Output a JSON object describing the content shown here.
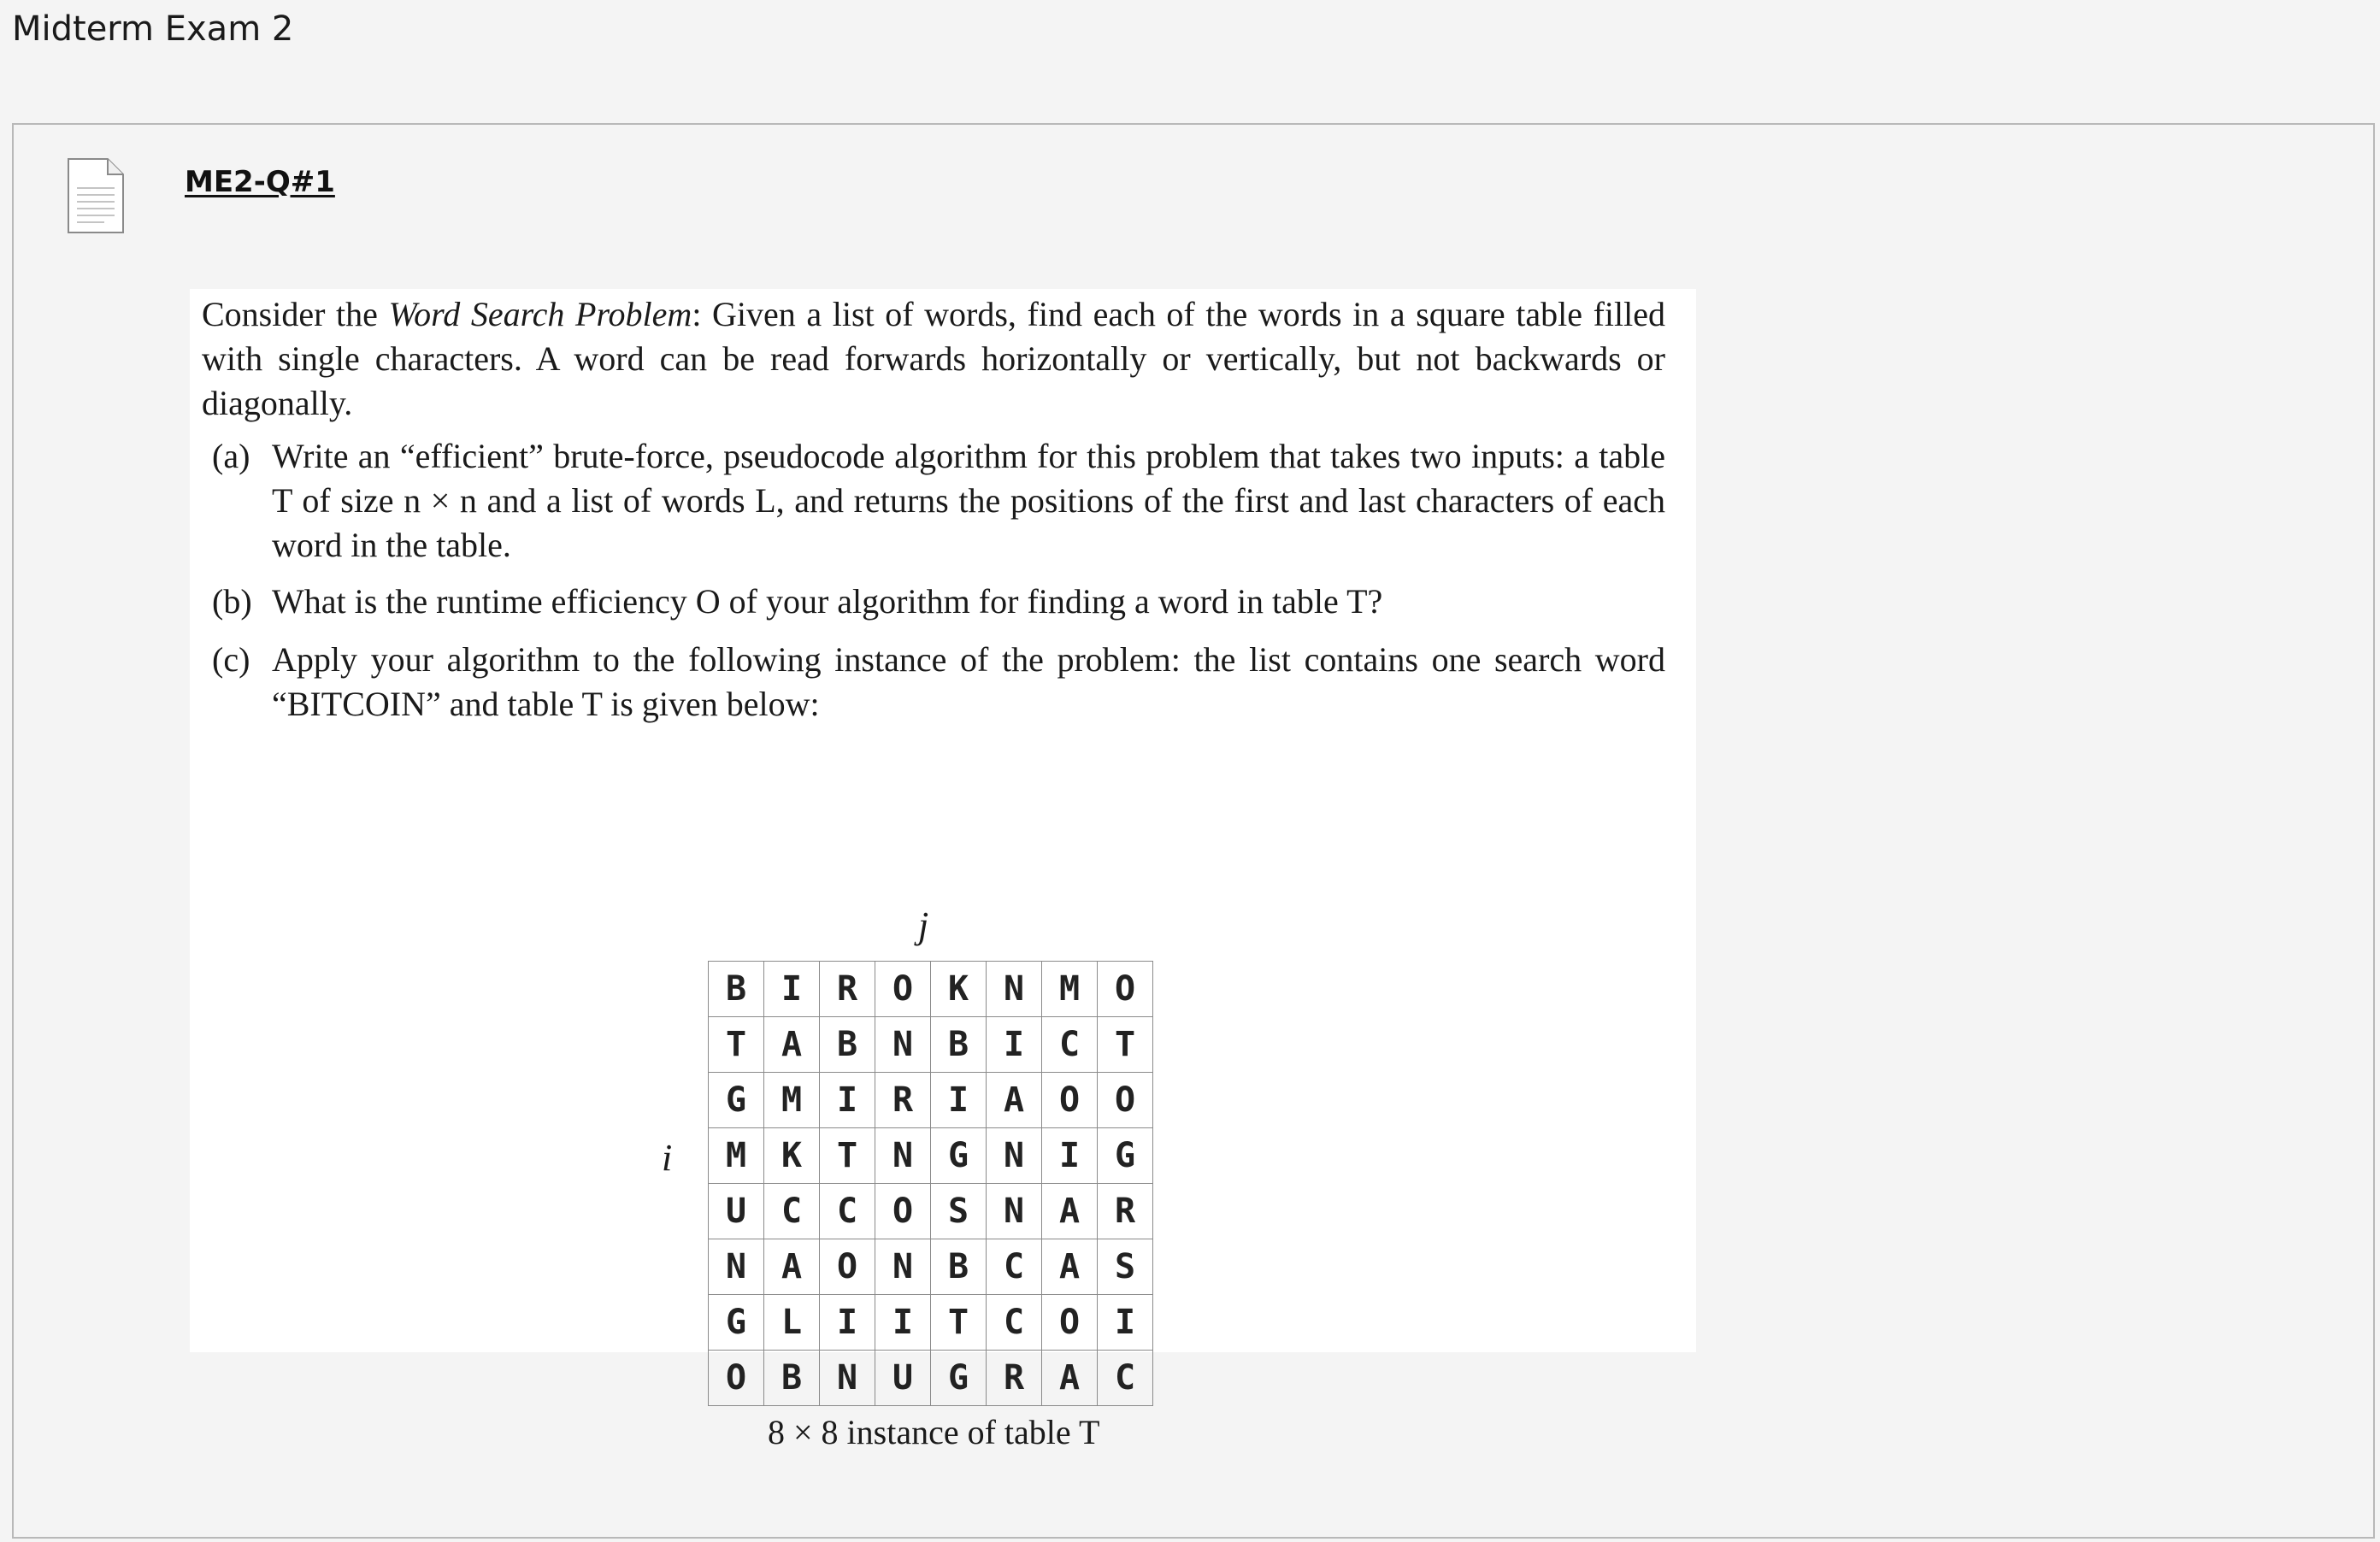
{
  "page": {
    "title": "Midterm Exam 2"
  },
  "item": {
    "icon": "file-document-icon",
    "link_label": "ME2-Q#1"
  },
  "question": {
    "intro_before": "Consider the ",
    "intro_problem_name": "Word Search Problem",
    "intro_after": ": Given a list of words, find each of the words in a square table filled with single characters.  A word can be read forwards horizontally or vertically, but not backwards or diagonally.",
    "parts": [
      {
        "label": "(a)",
        "text": "Write an “efficient” brute-force, pseudocode algorithm for this problem that takes two inputs: a table T of size n × n and a list of words L, and returns the positions of the first and last characters of each word in the table."
      },
      {
        "label": "(b)",
        "text": "What is the runtime efficiency O of your algorithm for finding a word in table T?"
      },
      {
        "label": "(c)",
        "text": "Apply your algorithm to the following instance of the problem: the list contains one search word “BITCOIN” and table T is given below:"
      }
    ],
    "table": {
      "column_axis_label": "j",
      "row_axis_label": "i",
      "rows": [
        [
          "B",
          "I",
          "R",
          "O",
          "K",
          "N",
          "M",
          "O"
        ],
        [
          "T",
          "A",
          "B",
          "N",
          "B",
          "I",
          "C",
          "T"
        ],
        [
          "G",
          "M",
          "I",
          "R",
          "I",
          "A",
          "O",
          "O"
        ],
        [
          "M",
          "K",
          "T",
          "N",
          "G",
          "N",
          "I",
          "G"
        ],
        [
          "U",
          "C",
          "C",
          "O",
          "S",
          "N",
          "A",
          "R"
        ],
        [
          "N",
          "A",
          "O",
          "N",
          "B",
          "C",
          "A",
          "S"
        ],
        [
          "G",
          "L",
          "I",
          "I",
          "T",
          "C",
          "O",
          "I"
        ],
        [
          "O",
          "B",
          "N",
          "U",
          "G",
          "R",
          "A",
          "C"
        ]
      ],
      "caption": "8 × 8 instance of table T"
    }
  }
}
